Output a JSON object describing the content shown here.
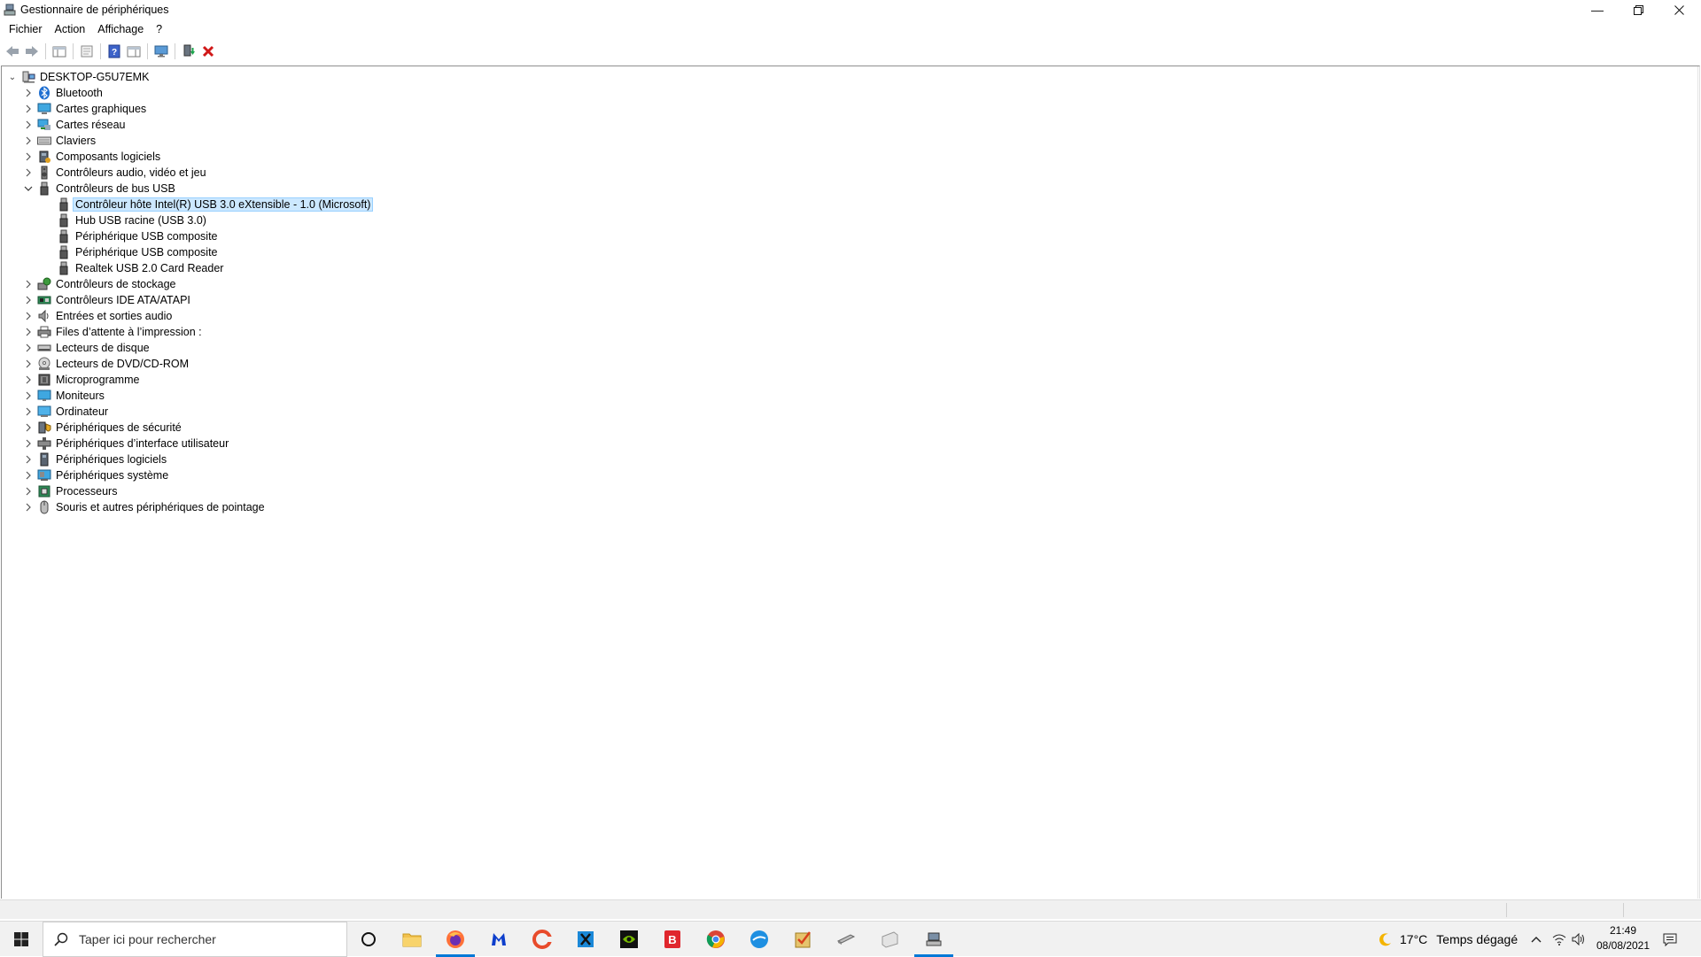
{
  "window": {
    "title": "Gestionnaire de périphériques"
  },
  "menu": [
    "Fichier",
    "Action",
    "Affichage",
    "?"
  ],
  "tree": {
    "root": "DESKTOP-G5U7EMK",
    "categories": [
      {
        "label": "Bluetooth",
        "icon": "bluetooth-icon",
        "expanded": false
      },
      {
        "label": "Cartes graphiques",
        "icon": "display-adapter-icon",
        "expanded": false
      },
      {
        "label": "Cartes réseau",
        "icon": "network-adapter-icon",
        "expanded": false
      },
      {
        "label": "Claviers",
        "icon": "keyboard-icon",
        "expanded": false
      },
      {
        "label": "Composants logiciels",
        "icon": "software-component-icon",
        "expanded": false
      },
      {
        "label": "Contrôleurs audio, vidéo et jeu",
        "icon": "audio-icon",
        "expanded": false
      },
      {
        "label": "Contrôleurs de bus USB",
        "icon": "usb-icon",
        "expanded": true,
        "children": [
          {
            "label": "Contrôleur hôte Intel(R) USB 3.0 eXtensible - 1.0 (Microsoft)",
            "selected": true
          },
          {
            "label": "Hub USB racine (USB 3.0)",
            "selected": false
          },
          {
            "label": "Périphérique USB composite",
            "selected": false
          },
          {
            "label": "Périphérique USB composite",
            "selected": false
          },
          {
            "label": "Realtek USB 2.0 Card Reader",
            "selected": false
          }
        ]
      },
      {
        "label": "Contrôleurs de stockage",
        "icon": "storage-controller-icon",
        "expanded": false
      },
      {
        "label": "Contrôleurs IDE ATA/ATAPI",
        "icon": "ide-controller-icon",
        "expanded": false
      },
      {
        "label": "Entrées et sorties audio",
        "icon": "audio-io-icon",
        "expanded": false
      },
      {
        "label": "Files d’attente à l’impression :",
        "icon": "printer-icon",
        "expanded": false
      },
      {
        "label": "Lecteurs de disque",
        "icon": "disk-drive-icon",
        "expanded": false
      },
      {
        "label": "Lecteurs de DVD/CD-ROM",
        "icon": "dvd-icon",
        "expanded": false
      },
      {
        "label": "Microprogramme",
        "icon": "firmware-icon",
        "expanded": false
      },
      {
        "label": "Moniteurs",
        "icon": "monitor-icon",
        "expanded": false
      },
      {
        "label": "Ordinateur",
        "icon": "computer-icon",
        "expanded": false
      },
      {
        "label": "Périphériques de sécurité",
        "icon": "security-device-icon",
        "expanded": false
      },
      {
        "label": "Périphériques d’interface utilisateur",
        "icon": "hid-icon",
        "expanded": false
      },
      {
        "label": "Périphériques logiciels",
        "icon": "software-device-icon",
        "expanded": false
      },
      {
        "label": "Périphériques système",
        "icon": "system-device-icon",
        "expanded": false
      },
      {
        "label": "Processeurs",
        "icon": "processor-icon",
        "expanded": false
      },
      {
        "label": "Souris et autres périphériques de pointage",
        "icon": "mouse-icon",
        "expanded": false
      }
    ]
  },
  "taskbar": {
    "search_placeholder": "Taper ici pour rechercher",
    "weather_temp": "17°C",
    "weather_text": "Temps dégagé",
    "time": "21:49",
    "date": "08/08/2021"
  },
  "colors": {
    "selection": "#cce8ff",
    "selection_border": "#99d1ff",
    "accent": "#0078d7"
  }
}
